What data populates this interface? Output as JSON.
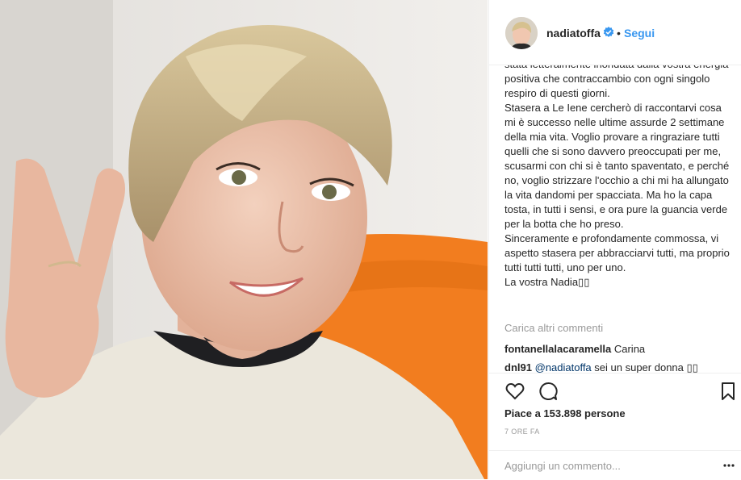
{
  "post": {
    "photo_icon": "portrait-photo"
  },
  "header": {
    "username": "nadiatoffa",
    "verified_icon": "verified-badge-icon",
    "separator": "•",
    "follow_label": "Segui"
  },
  "caption": {
    "text": "stata letteralmente inondata dalla vostra energia positiva che contraccambio con ogni singolo respiro di questi giorni.\nStasera a Le Iene cercherò di raccontarvi cosa mi è successo nelle ultime assurde 2 settimane della mia vita. Voglio provare a ringraziare tutti quelli che si sono davvero preoccupati per me, scusarmi con chi si è tanto spaventato, e perché no, voglio strizzare l'occhio a chi mi ha allungato la vita dandomi per spacciata. Ma ho la capa tosta, in tutti i sensi, e ora pure la guancia verde per la botta che ho preso.\nSinceramente e profondamente commossa, vi aspetto stasera per abbracciarvi tutti, ma proprio tutti tutti tutti, uno per uno.\nLa vostra Nadia▯▯"
  },
  "comments": {
    "load_more_label": "Carica altri commenti",
    "items": [
      {
        "user": "fontanellalacaramella",
        "mention": "",
        "text": "Carina"
      },
      {
        "user": "dnl91",
        "mention": "@nadiatoffa",
        "text": "sei un super donna ▯▯"
      }
    ]
  },
  "actions": {
    "like_icon": "heart-icon",
    "comment_icon": "comment-bubble-icon",
    "bookmark_icon": "bookmark-icon",
    "likes_text": "Piace a 153.898 persone",
    "time_text": "7 ORE FA"
  },
  "add_comment": {
    "placeholder": "Aggiungi un commento...",
    "more_icon": "more-options-icon"
  },
  "colors": {
    "link_blue": "#3897f0",
    "verified_blue": "#3897f0",
    "muted_text": "#999999",
    "mention_blue": "#003569",
    "orange_sofa": "#f27d1f"
  }
}
